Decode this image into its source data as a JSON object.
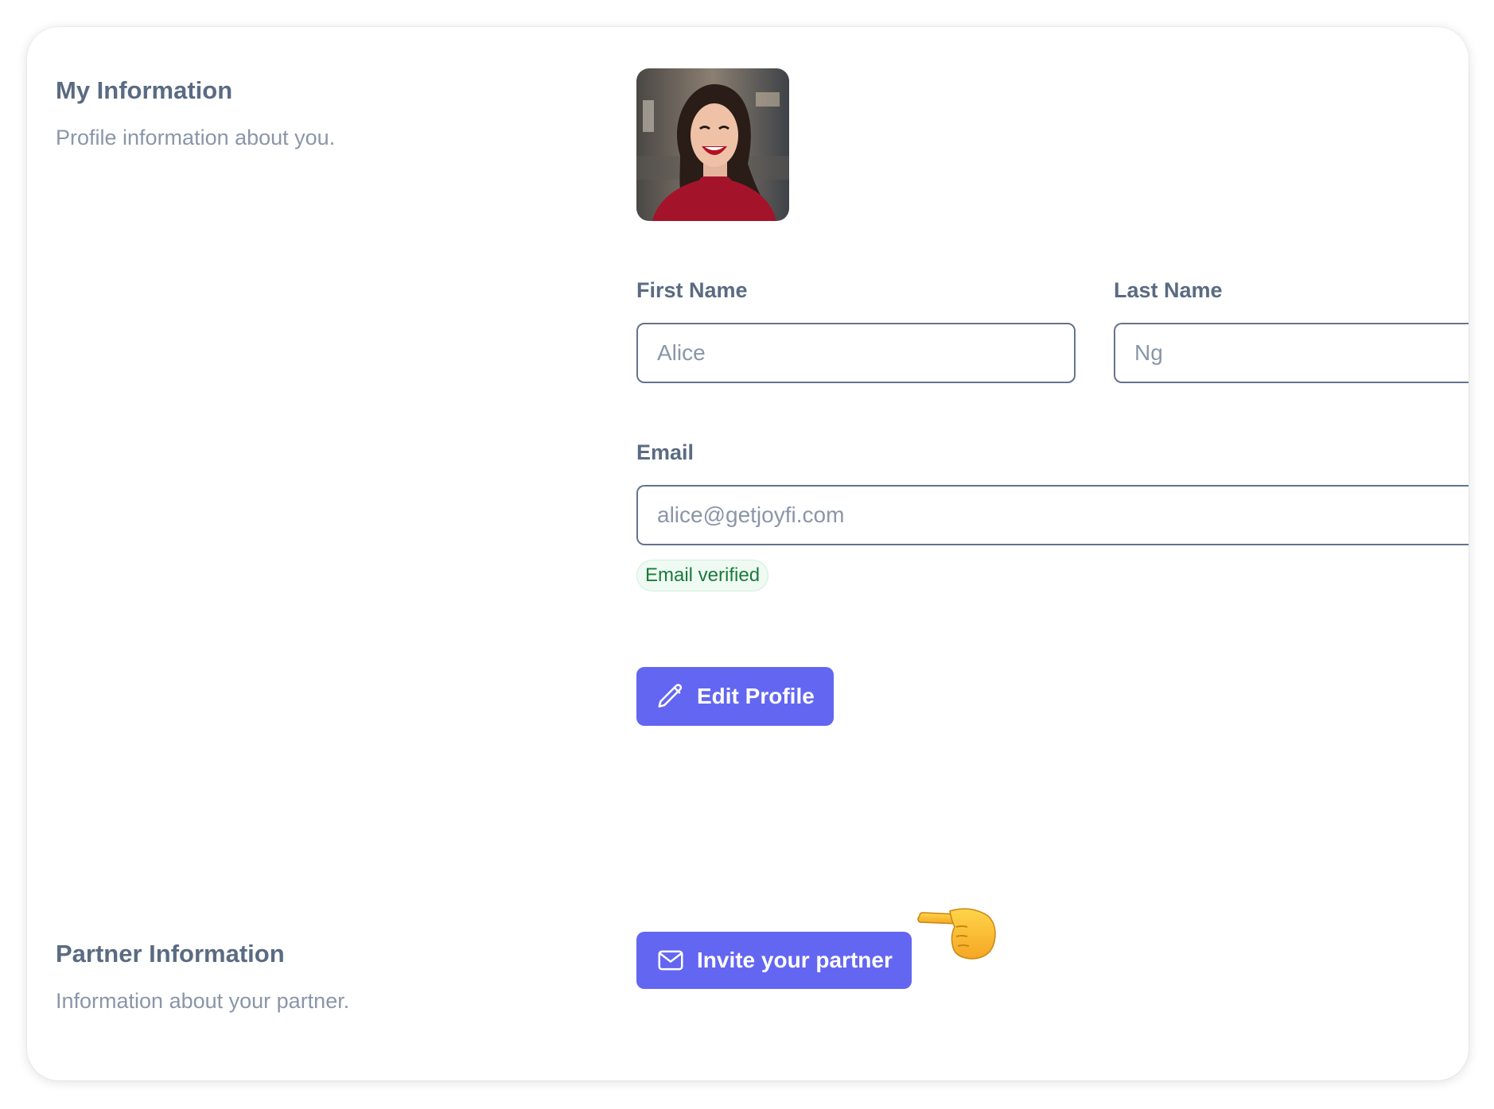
{
  "my_information": {
    "title": "My Information",
    "description": "Profile information about you."
  },
  "profile": {
    "avatar": "user-avatar-photo",
    "first_name": {
      "label": "First Name",
      "value": "Alice"
    },
    "last_name": {
      "label": "Last Name",
      "value": "Ng"
    },
    "email": {
      "label": "Email",
      "value": "alice@getjoyfi.com"
    },
    "email_status": "Email verified",
    "edit_button": {
      "label": "Edit Profile",
      "icon": "pencil-icon"
    }
  },
  "partner_information": {
    "title": "Partner Information",
    "description": "Information about your partner.",
    "invite_button": {
      "label": "Invite your partner",
      "icon": "mail-icon"
    },
    "pointer": "pointing-hand-emoji"
  },
  "colors": {
    "primary": "#6366f1",
    "heading": "#5a6b82",
    "muted": "#8a96a8",
    "success": "#1a7a3c"
  }
}
